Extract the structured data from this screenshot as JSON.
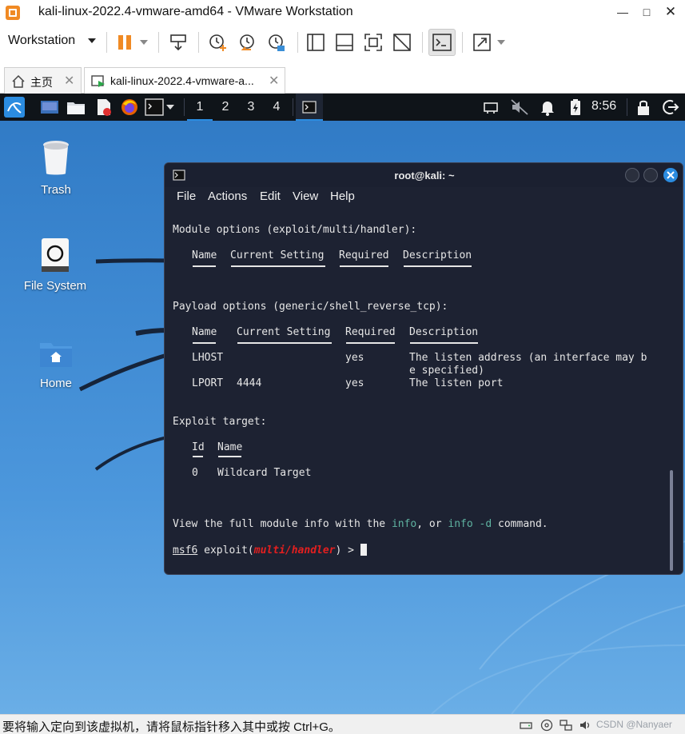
{
  "window": {
    "title": "kali-linux-2022.4-vmware-amd64 - VMware Workstation",
    "menu_label": "Workstation"
  },
  "tabs": [
    {
      "label": "主页"
    },
    {
      "label": "kali-linux-2022.4-vmware-a..."
    }
  ],
  "panel": {
    "workspaces": [
      "1",
      "2",
      "3",
      "4"
    ],
    "active_workspace": "1",
    "clock": "8:56"
  },
  "desktop": {
    "icons": [
      {
        "label": "Trash"
      },
      {
        "label": "File System"
      },
      {
        "label": "Home"
      }
    ]
  },
  "terminal": {
    "title": "root@kali: ~",
    "menu": [
      "File",
      "Actions",
      "Edit",
      "View",
      "Help"
    ],
    "module_options": "Module options (exploit/multi/handler):",
    "module_headers": [
      "Name",
      "Current Setting",
      "Required",
      "Description"
    ],
    "payload_options": "Payload options (generic/shell_reverse_tcp):",
    "payload_headers": [
      "Name",
      "Current Setting",
      "Required",
      "Description"
    ],
    "payload_rows": [
      {
        "name": "LHOST",
        "setting": "",
        "required": "yes",
        "description": "The listen address (an interface may b",
        "description_cont": "e specified)"
      },
      {
        "name": "LPORT",
        "setting": "4444",
        "required": "yes",
        "description": "The listen port",
        "description_cont": ""
      }
    ],
    "exploit_target": "Exploit target:",
    "target_headers": [
      "Id",
      "Name"
    ],
    "target_rows": [
      {
        "id": "0",
        "name": "Wildcard Target"
      }
    ],
    "info_prefix": "View the full module info with the ",
    "info_cmd": "info",
    "info_mid": ", or ",
    "info_cmd2": "info -d",
    "info_suffix": " command.",
    "prompt_name": "msf6",
    "prompt_exploit": " exploit(",
    "prompt_module": "multi/handler",
    "prompt_end": ") > "
  },
  "statusbar": {
    "message": "要将输入定向到该虚拟机，请将鼠标指针移入其中或按 Ctrl+G。",
    "watermark": "CSDN @Nanyaer"
  },
  "colors": {
    "accent": "#2b8ce0",
    "terminal_bg": "#1d2232",
    "command_teal": "#5fb3a1",
    "module_red": "#e31f1f",
    "pause_orange": "#f08a24"
  }
}
